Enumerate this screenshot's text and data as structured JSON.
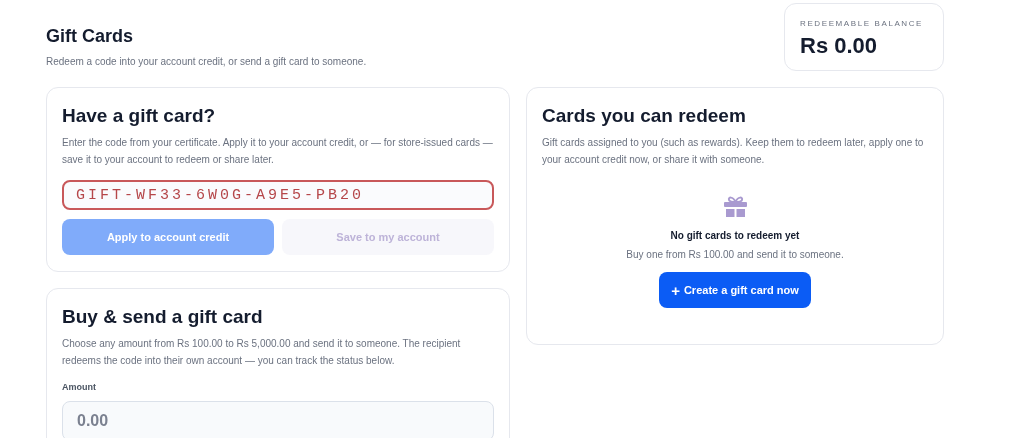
{
  "header": {
    "title": "Gift Cards",
    "subtitle": "Redeem a code into your account credit, or send a gift card to someone."
  },
  "balance": {
    "label": "REDEEMABLE BALANCE",
    "amount": "Rs 0.00"
  },
  "redeem_card": {
    "title": "Have a gift card?",
    "description": "Enter the code from your certificate. Apply it to your account credit, or — for store-issued cards — save it to your account to redeem or share later.",
    "code_field": {
      "value": "GIFT-WF33-6W0G-A9E5-PB20",
      "invalid": true
    },
    "buttons": [
      {
        "label": "Apply to account credit",
        "kind": "primary",
        "disabled": true
      },
      {
        "label": "Save to my account",
        "kind": "secondary",
        "disabled": true
      }
    ]
  },
  "buy_card": {
    "title": "Buy & send a gift card",
    "description": "Choose any amount from Rs 100.00 to Rs 5,000.00 and send it to someone. The recipient redeems the code into their own account — you can track the status below.",
    "amount_field": {
      "label": "Amount",
      "placeholder": "0.00"
    }
  },
  "redeemable_cards": {
    "title": "Cards you can redeem",
    "description": "Gift cards assigned to you (such as rewards). Keep them to redeem later, apply one to your account credit now, or share it with someone.",
    "empty_state": {
      "title": "No gift cards to redeem yet",
      "text": "Buy one from Rs 100.00 and send it to someone.",
      "button": {
        "icon": "+",
        "label": "Create a gift card now"
      }
    }
  }
}
